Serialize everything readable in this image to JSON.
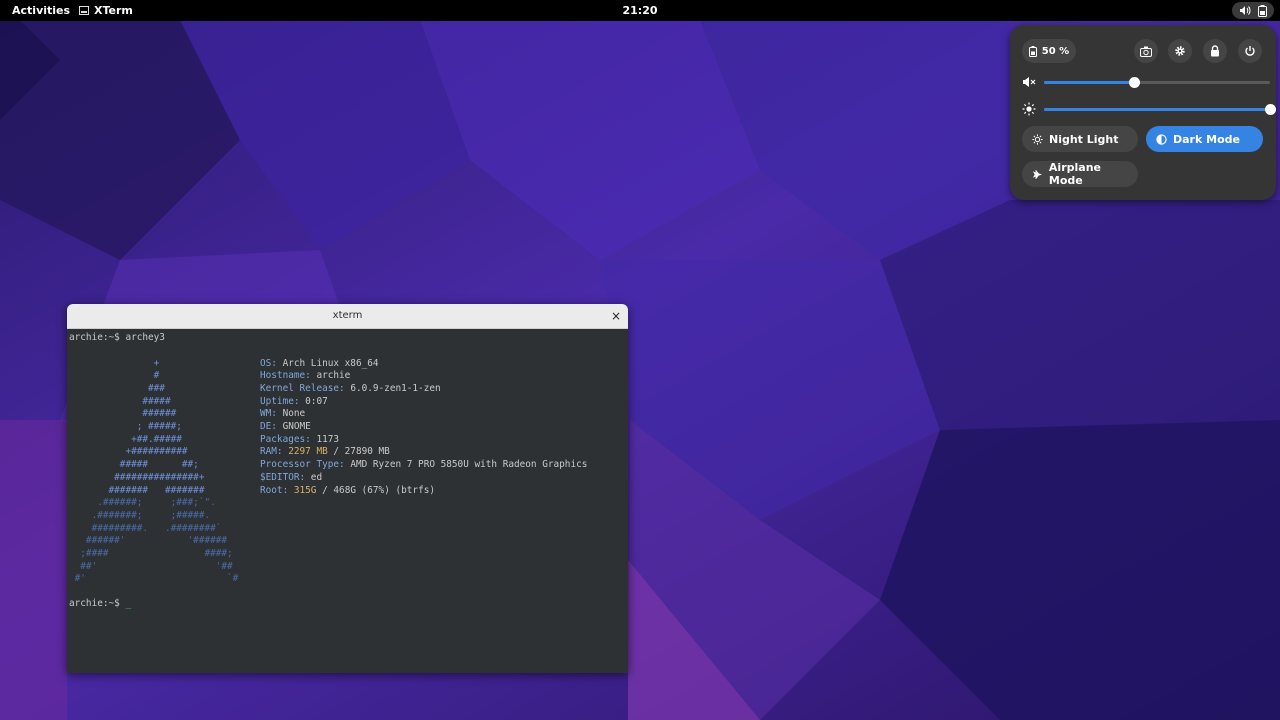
{
  "topbar": {
    "activities": "Activities",
    "app_name": "XTerm",
    "clock": "21:20"
  },
  "quick_settings": {
    "battery_label": "50 %",
    "volume_percent": 40,
    "brightness_percent": 100,
    "toggles": {
      "night_light": "Night Light",
      "dark_mode": "Dark Mode",
      "airplane_mode": "Airplane Mode"
    },
    "accent_color": "#3584e4"
  },
  "xterm": {
    "title": "xterm",
    "close_glyph": "×",
    "command_line": "archie:~$ archey3",
    "prompt": "archie:~$ ",
    "cursor": "_",
    "logo_lines": [
      "               +",
      "               #",
      "              ###",
      "             #####",
      "             ######",
      "            ; #####;",
      "           +##.#####",
      "          +##########",
      "         #####      ##;",
      "        ###############+",
      "       #######   #######",
      "     .######;     ;###;`\".",
      "    .#######;     ;#####.",
      "    #########.   .########`",
      "   ######'           '######",
      "  ;####                 ####;",
      "  ##'                     '##",
      " #'                         `#"
    ],
    "info": [
      {
        "key": "OS:",
        "value": " Arch Linux x86_64"
      },
      {
        "key": "Hostname:",
        "value": " archie"
      },
      {
        "key": "Kernel Release:",
        "value": " 6.0.9-zen1-1-zen"
      },
      {
        "key": "Uptime:",
        "value": " 0:07"
      },
      {
        "key": "WM:",
        "value": " None"
      },
      {
        "key": "DE:",
        "value": " GNOME"
      },
      {
        "key": "Packages:",
        "value": " 1173"
      },
      {
        "key": "RAM:",
        "value_num": " 2297 MB",
        "value_rest": " / 27890 MB"
      },
      {
        "key": "Processor Type:",
        "value": " AMD Ryzen 7 PRO 5850U with Radeon Graphics"
      },
      {
        "key": "$EDITOR:",
        "value": " ed"
      },
      {
        "key": "Root:",
        "value_num": " 315G",
        "value_rest": " / 468G (67%) (btrfs)"
      }
    ]
  }
}
